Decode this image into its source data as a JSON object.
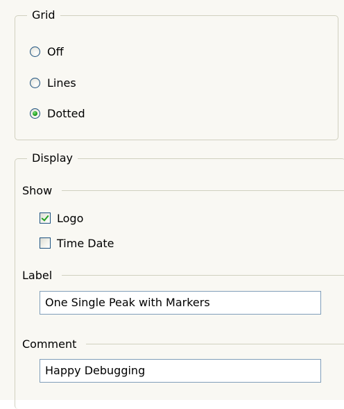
{
  "grid": {
    "title": "Grid",
    "options": [
      {
        "label": "Off",
        "checked": false
      },
      {
        "label": "Lines",
        "checked": false
      },
      {
        "label": "Dotted",
        "checked": true
      }
    ]
  },
  "display": {
    "title": "Display",
    "show": {
      "title": "Show",
      "logo_label": "Logo",
      "logo_checked": true,
      "time_date_label": "Time Date",
      "time_date_checked": false
    },
    "label": {
      "title": "Label",
      "value": "One Single Peak with Markers"
    },
    "comment": {
      "title": "Comment",
      "value": "Happy Debugging"
    }
  },
  "colors": {
    "panel_bg": "#f9f8f3",
    "group_border": "#d0d0bf",
    "control_border": "#1c5180",
    "check_accent": "#21a121",
    "textbox_border": "#7f9db9"
  }
}
